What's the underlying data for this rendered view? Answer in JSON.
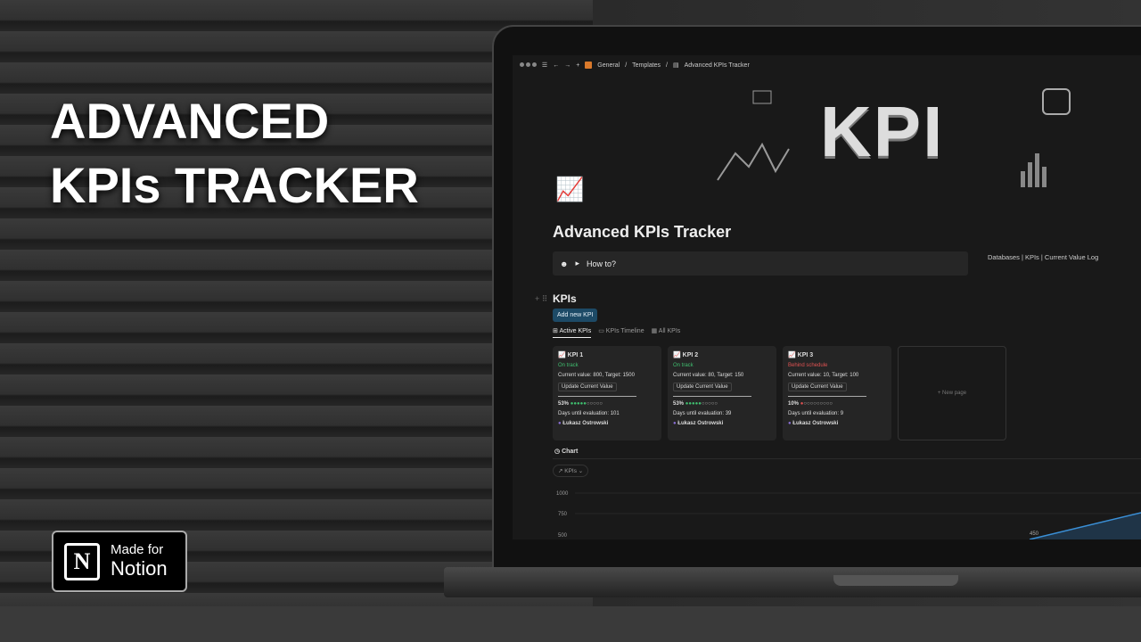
{
  "hero": {
    "line1": "ADVANCED",
    "line2": "KPIs TRACKER"
  },
  "badge": {
    "line1": "Made for",
    "line2": "Notion",
    "logo_letter": "N"
  },
  "topbar": {
    "breadcrumb": [
      "General",
      "Templates",
      "Advanced KPIs Tracker"
    ],
    "separator": "/"
  },
  "banner": {
    "text": "KPI"
  },
  "page": {
    "title": "Advanced KPIs Tracker",
    "toggle": "How to?",
    "links": "Databases | KPIs | Current Value Log"
  },
  "kpis": {
    "heading": "KPIs",
    "add_button": "Add new KPI",
    "tabs": [
      "Active KPIs",
      "KPIs Timeline",
      "All KPIs"
    ],
    "cards": [
      {
        "name": "KPI 1",
        "status": "On track",
        "status_color": "#3fbf6f",
        "values": "Current value: 800, Target: 1500",
        "button": "Update Current Value",
        "progress": "53%",
        "filled": 5,
        "fill_color": "#3fbf6f",
        "days": "Days until evaluation: 101",
        "owner": "Łukasz Ostrowski"
      },
      {
        "name": "KPI 2",
        "status": "On track",
        "status_color": "#3fbf6f",
        "values": "Current value: 80, Target: 150",
        "button": "Update Current Value",
        "progress": "53%",
        "filled": 5,
        "fill_color": "#3fbf6f",
        "days": "Days until evaluation: 39",
        "owner": "Łukasz Ostrowski"
      },
      {
        "name": "KPI 3",
        "status": "Behind schedule",
        "status_color": "#e05252",
        "values": "Current value: 10, Target: 100",
        "button": "Update Current Value",
        "progress": "10%",
        "filled": 1,
        "fill_color": "#e05252",
        "days": "Days until evaluation: 9",
        "owner": "Łukasz Ostrowski"
      }
    ],
    "new_page": "+ New page"
  },
  "chart": {
    "heading": "Chart",
    "chip": "KPIs",
    "y_ticks": [
      "1000",
      "750",
      "500"
    ],
    "data_label": "450",
    "line_color": "#3a8fd6"
  }
}
